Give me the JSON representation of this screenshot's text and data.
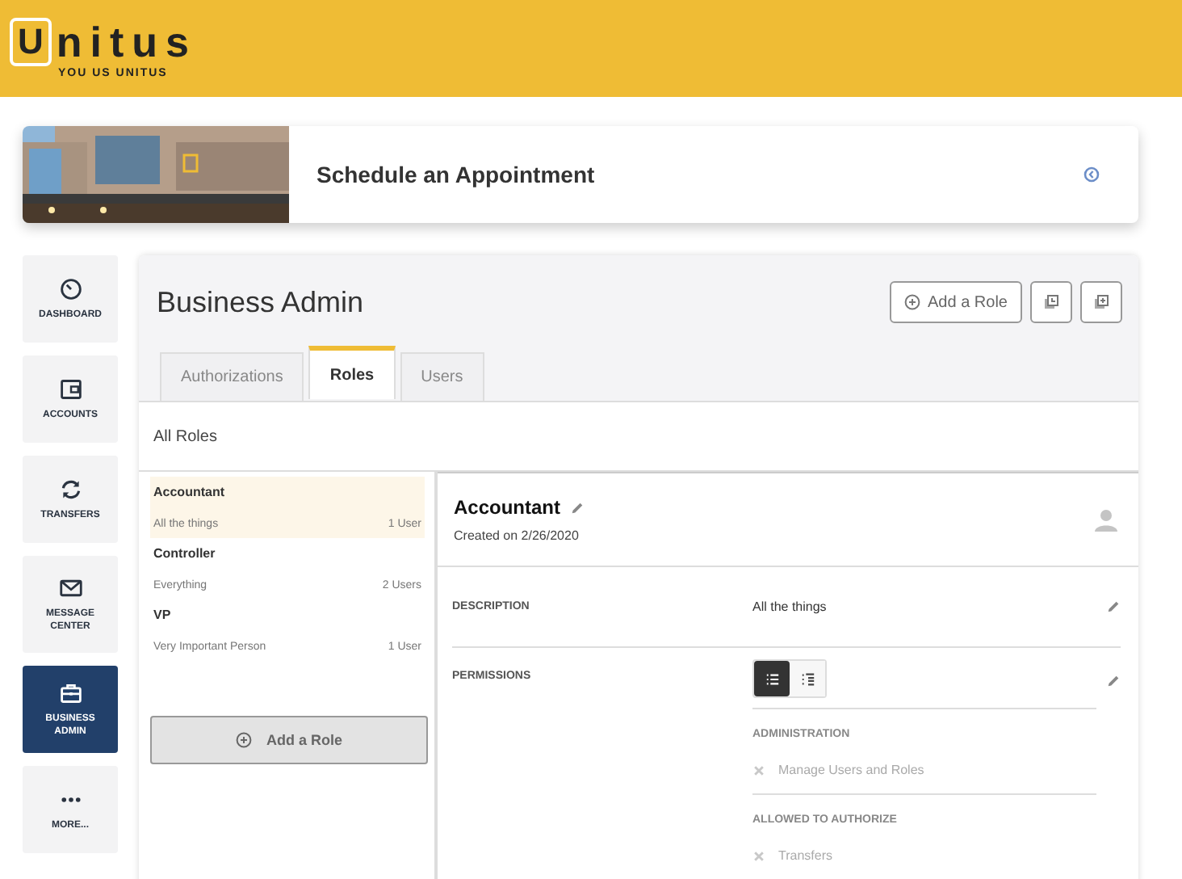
{
  "logo": {
    "boxed_letter": "U",
    "rest": "nitus",
    "tagline": "YOU US UNITUS"
  },
  "banner": {
    "kind": "picture",
    "title": "Schedule an Appointment"
  },
  "nav": [
    {
      "label": "DASHBOARD",
      "selected": false
    },
    {
      "label": "ACCOUNTS",
      "selected": false
    },
    {
      "label": "TRANSFERS",
      "selected": false
    },
    {
      "label": "MESSAGE CENTER",
      "selected": false
    },
    {
      "label": "BUSINESS ADMIN",
      "selected": true
    },
    {
      "label": "MORE...",
      "selected": false
    }
  ],
  "page": {
    "title": "Business Admin",
    "add_button": "Add a Role"
  },
  "tabs": [
    {
      "label": "Authorizations",
      "selected": false
    },
    {
      "label": "Roles",
      "selected": true
    },
    {
      "label": "Users",
      "selected": false
    }
  ],
  "section_title": "All Roles",
  "roles": [
    {
      "name": "Accountant",
      "description": "All the things",
      "users": "1 User",
      "selected": true
    },
    {
      "name": "Controller",
      "description": "Everything",
      "users": "2 Users",
      "selected": false
    },
    {
      "name": "VP",
      "description": "Very Important Person",
      "users": "1 User",
      "selected": false
    }
  ],
  "add_role_button": "Add a Role",
  "detail": {
    "name": "Accountant",
    "created": "Created on 2/26/2020",
    "description_label": "DESCRIPTION",
    "description": "All the things",
    "permissions_label": "PERMISSIONS",
    "views": [
      {
        "selected": true
      },
      {
        "selected": false
      }
    ],
    "groups": [
      {
        "title": "ADMINISTRATION",
        "items": [
          {
            "label": "Manage Users and Roles",
            "allowed": false
          }
        ]
      },
      {
        "title": "ALLOWED TO AUTHORIZE",
        "items": [
          {
            "label": "Transfers",
            "allowed": false
          }
        ]
      }
    ]
  }
}
